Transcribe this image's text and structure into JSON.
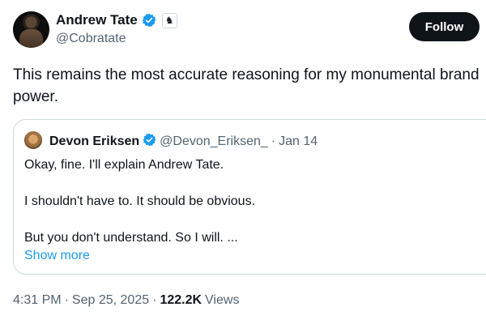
{
  "author": {
    "display_name": "Andrew Tate",
    "handle": "@Cobratate",
    "verified_color": "#1d9bf0",
    "affiliate_icon": "chess-knight-icon"
  },
  "follow_button": {
    "label": "Follow",
    "color": "#0f1419"
  },
  "tweet": {
    "text": "This remains the most accurate reasoning for my monumental brand\npower."
  },
  "quote": {
    "display_name": "Devon Eriksen",
    "handle": "@Devon_Eriksen_",
    "separator": "·",
    "date": "Jan 14",
    "lines": [
      "Okay, fine. I'll explain Andrew Tate.",
      "I shouldn't have to. It should be obvious.",
      "But you don't understand. So I will. ..."
    ],
    "show_more": "Show more"
  },
  "meta": {
    "time": "4:31 PM",
    "sep1": "·",
    "date": "Sep 25, 2025",
    "sep2": "·",
    "views_count": "122.2K",
    "views_label": "Views"
  }
}
